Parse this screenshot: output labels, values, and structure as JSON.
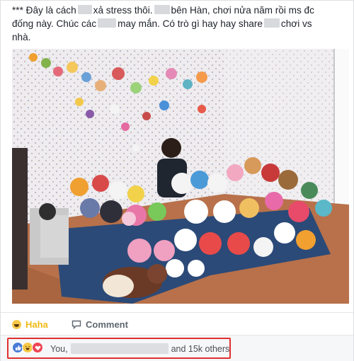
{
  "post": {
    "line1_a": "*** Đây là cách",
    "line1_b": "xả stress thôi.",
    "line1_c": "bên Hàn, chơi nửa năm rồi ms đc",
    "line2_a": "đống này. Chúc các",
    "line2_b": "may mắn. Có trò gì hay hay share",
    "line2_c": "chơi vs",
    "line3": "nhà."
  },
  "actions": {
    "haha_label": "Haha",
    "comment_label": "Comment"
  },
  "reactions": {
    "you": "You,",
    "others": "and 15k others",
    "types": [
      "like-icon",
      "haha-icon",
      "love-icon"
    ]
  },
  "colors": {
    "haha_accent": "#f0ba15",
    "like_blue": "#4a7bd7",
    "love_red": "#ed4656",
    "highlight_red": "#e03030"
  }
}
